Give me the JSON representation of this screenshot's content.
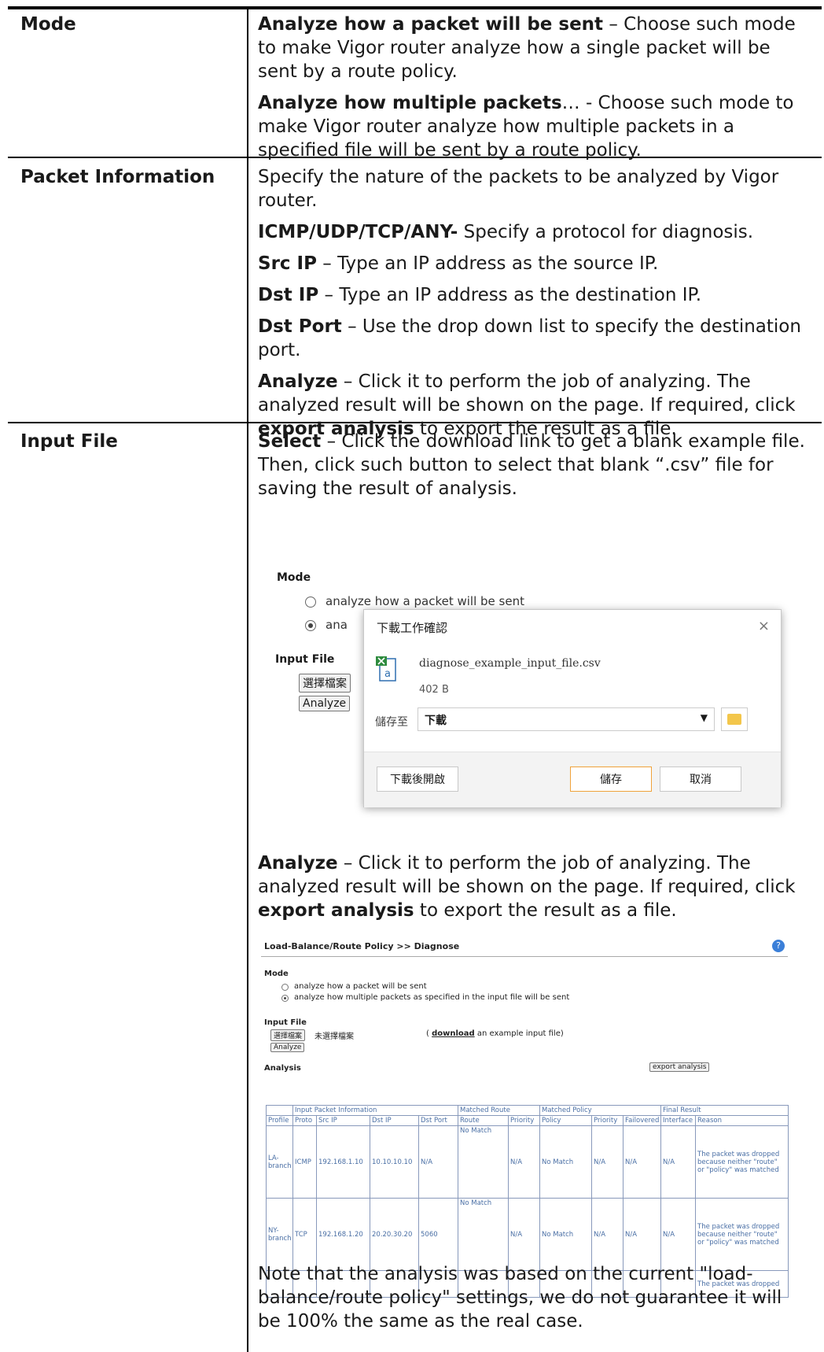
{
  "rows": [
    {
      "label": "Mode",
      "items": [
        {
          "term": "Analyze how a packet will be sent",
          "text": " – Choose such mode to make Vigor router analyze how a single packet will be sent by a route policy."
        },
        {
          "term": "Analyze how multiple packets",
          "text": "… - Choose such mode to make Vigor router analyze how multiple packets in a specified file will be sent by a route policy."
        }
      ]
    },
    {
      "label": "Packet Information",
      "items": [
        {
          "term": "",
          "text": "Specify the nature of the packets to be analyzed by Vigor router."
        },
        {
          "term": "ICMP/UDP/TCP/ANY-",
          "text": " Specify a protocol for diagnosis."
        },
        {
          "term": "Src IP",
          "text": " – Type an IP address as the source IP."
        },
        {
          "term": "Dst IP",
          "text": " – Type an IP address as the destination IP."
        },
        {
          "term": "Dst Port",
          "text": " – Use the drop down list to specify the destination port."
        },
        {
          "term": "Analyze",
          "text": " – Click it to perform the job of analyzing. The analyzed result will be shown on the page. If required, click ",
          "term2": "export analysis",
          "text2": " to export the result as a file."
        }
      ]
    },
    {
      "label": "Input File",
      "select_term": "Select",
      "select_text": " – Click the download link to get a blank example file. Then, click such button to select that blank “.csv” file for saving the result of analysis.",
      "analyze_term": "Analyze",
      "analyze_text": " – Click it to perform the job of analyzing. The analyzed result will be shown on the page. If required, click ",
      "analyze_term2": "export analysis",
      "analyze_text2": " to export the result as a file.",
      "note": "Note that the analysis was based on the current \"load-balance/route policy\" settings, we do not guarantee it will be 100% the same as the real case."
    }
  ],
  "figure_download": {
    "mode_label": "Mode",
    "option1": "analyze how a packet will be sent",
    "option2_partial": "ana",
    "input_file_label": "Input File",
    "choose_file_btn": "選擇檔案",
    "analyze_btn": "Analyze",
    "dialog": {
      "title": "下載工作確認",
      "close": "×",
      "filename": "diagnose_example_input_file.csv",
      "filesize": "402 B",
      "save_to_label": "儲存至",
      "save_to_value": "下載",
      "open_after_btn": "下載後開啟",
      "save_btn": "儲存",
      "cancel_btn": "取消"
    }
  },
  "figure_diagnose": {
    "header": "Load-Balance/Route Policy >> Diagnose",
    "help": "?",
    "mode_label": "Mode",
    "option1": "analyze how a packet will be sent",
    "option2": "analyze how multiple packets as specified in the input file will be sent",
    "input_file_label": "Input File",
    "choose_file_btn": "選擇檔案",
    "no_file_text": "未選擇檔案",
    "download_prefix": "(",
    "download_link": "download",
    "download_suffix": " an example input file)",
    "analyze_btn": "Analyze",
    "analysis_label": "Analysis",
    "export_btn": "export analysis",
    "group_headers": [
      "Input Packet Information",
      "Matched Route",
      "Matched Policy",
      "Final Result"
    ],
    "columns": [
      "Profile",
      "Proto",
      "Src IP",
      "Dst IP",
      "Dst Port",
      "Route",
      "Priority",
      "Policy",
      "Priority",
      "Failovered",
      "Interface",
      "Reason"
    ],
    "data_rows": [
      [
        "LA-branch",
        "ICMP",
        "192.168.1.10",
        "10.10.10.10",
        "N/A",
        "No Match",
        "N/A",
        "No Match",
        "N/A",
        "N/A",
        "N/A",
        "The packet was dropped because neither \"route\" or \"policy\" was matched"
      ],
      [
        "NY-branch",
        "TCP",
        "192.168.1.20",
        "20.20.30.20",
        "5060",
        "No Match",
        "N/A",
        "No Match",
        "N/A",
        "N/A",
        "N/A",
        "The packet was dropped because neither \"route\" or \"policy\" was matched"
      ],
      [
        "",
        "",
        "",
        "",
        "",
        "",
        "",
        "",
        "",
        "",
        "",
        "The packet was dropped"
      ]
    ]
  }
}
